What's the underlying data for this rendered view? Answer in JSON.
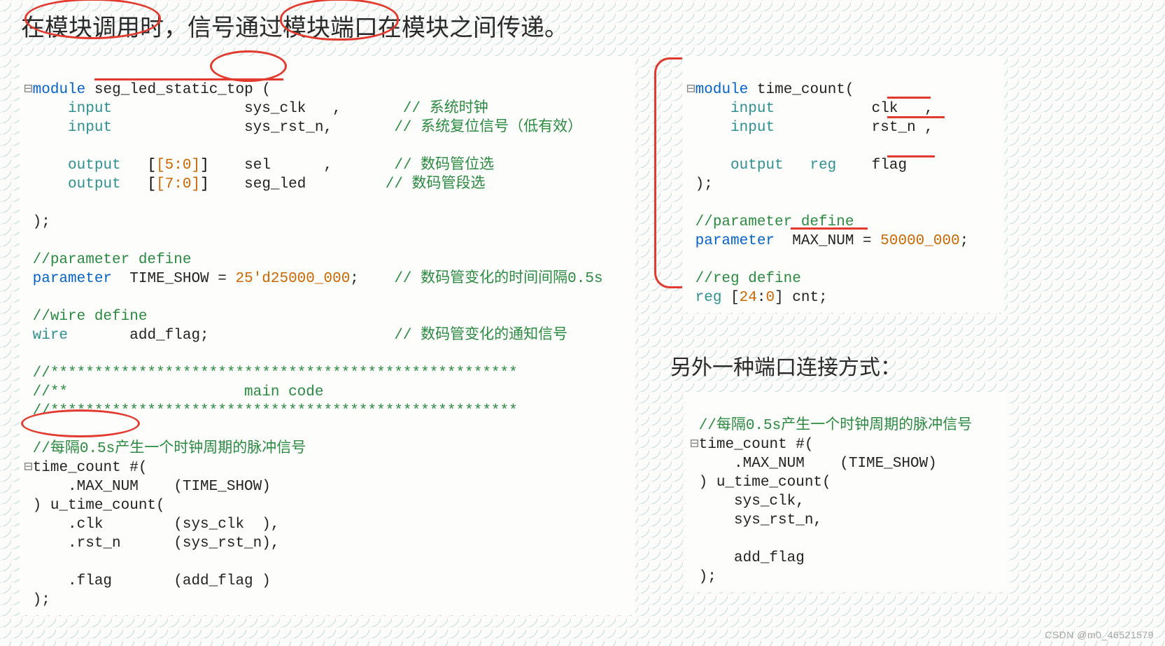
{
  "title": "在模块调用时，信号通过模块端口在模块之间传递。",
  "left_code": {
    "l01a": "module",
    "l01b": " seg_led_static_top (",
    "l02a": "input",
    "l02b": "sys_clk   ,",
    "l02c": "// 系统时钟",
    "l03a": "input",
    "l03b": "sys_rst_n,",
    "l03c": "// 系统复位信号（低有效）",
    "l04a": "output",
    "l04b": "[5:0]",
    "l04c": "sel      ,",
    "l04d": "// 数码管位选",
    "l05a": "output",
    "l05b": "[7:0]",
    "l05c": "seg_led",
    "l05d": "// 数码管段选",
    "l06": ");",
    "l07": "//parameter define",
    "l08a": "parameter",
    "l08b": "  TIME_SHOW = ",
    "l08c": "25'd25000_000",
    "l08d": ";",
    "l08e": "// 数码管变化的时间间隔0.5s",
    "l09": "//wire define",
    "l10a": "wire",
    "l10b": "       add_flag;",
    "l10c": "// 数码管变化的通知信号",
    "l11": "//*****************************************************",
    "l12": "//**                    main code",
    "l13": "//*****************************************************",
    "l14": "//每隔0.5s产生一个时钟周期的脉冲信号",
    "l15": "time_count #(",
    "l16": "    .MAX_NUM    (TIME_SHOW)",
    "l17": ") u_time_count(",
    "l18": "    .clk        (sys_clk  ),",
    "l19": "    .rst_n      (sys_rst_n),",
    "l20": "    .flag       (add_flag )",
    "l21": ");"
  },
  "right_code": {
    "r01a": "module",
    "r01b": " time_count(",
    "r02a": "input",
    "r02b": "clk   ,",
    "r03a": "input",
    "r03b": "rst_n ,",
    "r04a": "output",
    "r04b": "reg",
    "r04c": "flag",
    "r05": ");",
    "r06": "//parameter define",
    "r07a": "parameter",
    "r07b": "  MAX_NUM = ",
    "r07c": "50000_000",
    "r07d": ";",
    "r08": "//reg define",
    "r09a": "reg",
    "r09b": " [",
    "r09c": "24",
    "r09d": ":",
    "r09e": "0",
    "r09f": "] cnt;"
  },
  "caption_alt": "另外一种端口连接方式：",
  "alt_code": {
    "a01": "//每隔0.5s产生一个时钟周期的脉冲信号",
    "a02": "time_count #(",
    "a03": "    .MAX_NUM    (TIME_SHOW)",
    "a04": ") u_time_count(",
    "a05": "    sys_clk,",
    "a06": "    sys_rst_n,",
    "a07": "    add_flag",
    "a08": ");"
  },
  "watermark": "CSDN @m0_46521579"
}
